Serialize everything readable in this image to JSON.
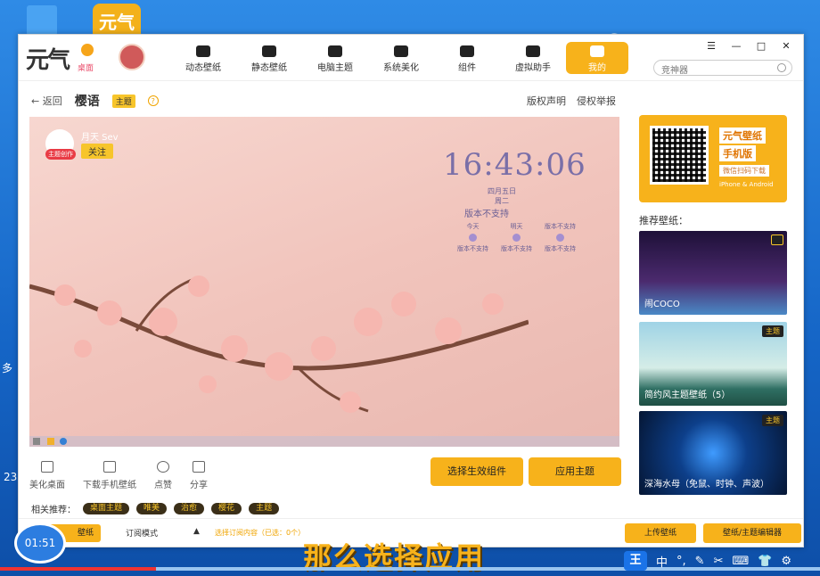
{
  "desktop": {
    "icon_text": "元气",
    "left_text": "多",
    "left_num": "23",
    "watermark": "@"
  },
  "app": {
    "logo": "元气",
    "logo_sub": "桌面",
    "nav": [
      {
        "label": "动态壁纸",
        "icon": "video-icon"
      },
      {
        "label": "静态壁纸",
        "icon": "image-icon"
      },
      {
        "label": "电脑主题",
        "icon": "shirt-icon"
      },
      {
        "label": "系统美化",
        "icon": "gear-icon"
      },
      {
        "label": "组件",
        "icon": "widget-icon"
      },
      {
        "label": "虚拟助手",
        "icon": "paw-icon"
      },
      {
        "label": "我的",
        "icon": "user-icon",
        "active": true
      }
    ],
    "window_controls": [
      "☰",
      "—",
      "□",
      "✕"
    ],
    "search_placeholder": "竞神器"
  },
  "page": {
    "back": "← 返回",
    "title": "樱语",
    "tag": "主题",
    "help": "?",
    "copyright": "版权声明",
    "report": "侵权举报"
  },
  "preview": {
    "author_name": "月天 Sev",
    "author_badge": "主题创作",
    "follow": "关注",
    "clock_time": "16:43:06",
    "clock_date": "四月五日",
    "clock_weekday": "周二",
    "clock_note": "版本不支持",
    "weather": [
      {
        "day": "今天",
        "text": "版本不支持"
      },
      {
        "day": "明天",
        "text": "版本不支持"
      },
      {
        "day": "版本不支持",
        "text": "版本不支持"
      }
    ]
  },
  "actions": [
    {
      "label": "美化桌面",
      "icon": "desktop-icon"
    },
    {
      "label": "下载手机壁纸",
      "icon": "phone-icon"
    },
    {
      "label": "点赞",
      "icon": "heart-icon"
    },
    {
      "label": "分享",
      "icon": "share-icon"
    }
  ],
  "buttons": {
    "select_widget": "选择生效组件",
    "apply_theme": "应用主题"
  },
  "related": {
    "label": "相关推荐：",
    "chips": [
      "桌面主题",
      "唯美",
      "治愈",
      "樱花",
      "主题"
    ]
  },
  "bottombar": {
    "left_btn": "壁纸",
    "subscribe_mode": "订阅模式",
    "subscribe_arrow": "▲",
    "subscribe_note": "选择订阅内容（已选：0个）",
    "upload": "上传壁纸",
    "editor": "壁纸/主题编辑器"
  },
  "promo": {
    "t1": "元气壁纸",
    "t2": "手机版",
    "t3": "微信扫码下载",
    "t4": "iPhone & Android"
  },
  "recommend": {
    "title": "推荐壁纸：",
    "cards": [
      {
        "label": "闹COCO",
        "badge": ""
      },
      {
        "label": "简约风主题壁纸（5）",
        "badge": "主题"
      },
      {
        "label": "深海水母（免鼠、时钟、声波）",
        "badge": "主题"
      }
    ]
  },
  "overlay": {
    "subtitle": "那么选择应用",
    "timer": "01:51",
    "progress": 0.19
  },
  "tray": [
    "王",
    "中",
    "°,",
    "✎",
    "✂",
    "⌨",
    "👕",
    "⚙"
  ]
}
